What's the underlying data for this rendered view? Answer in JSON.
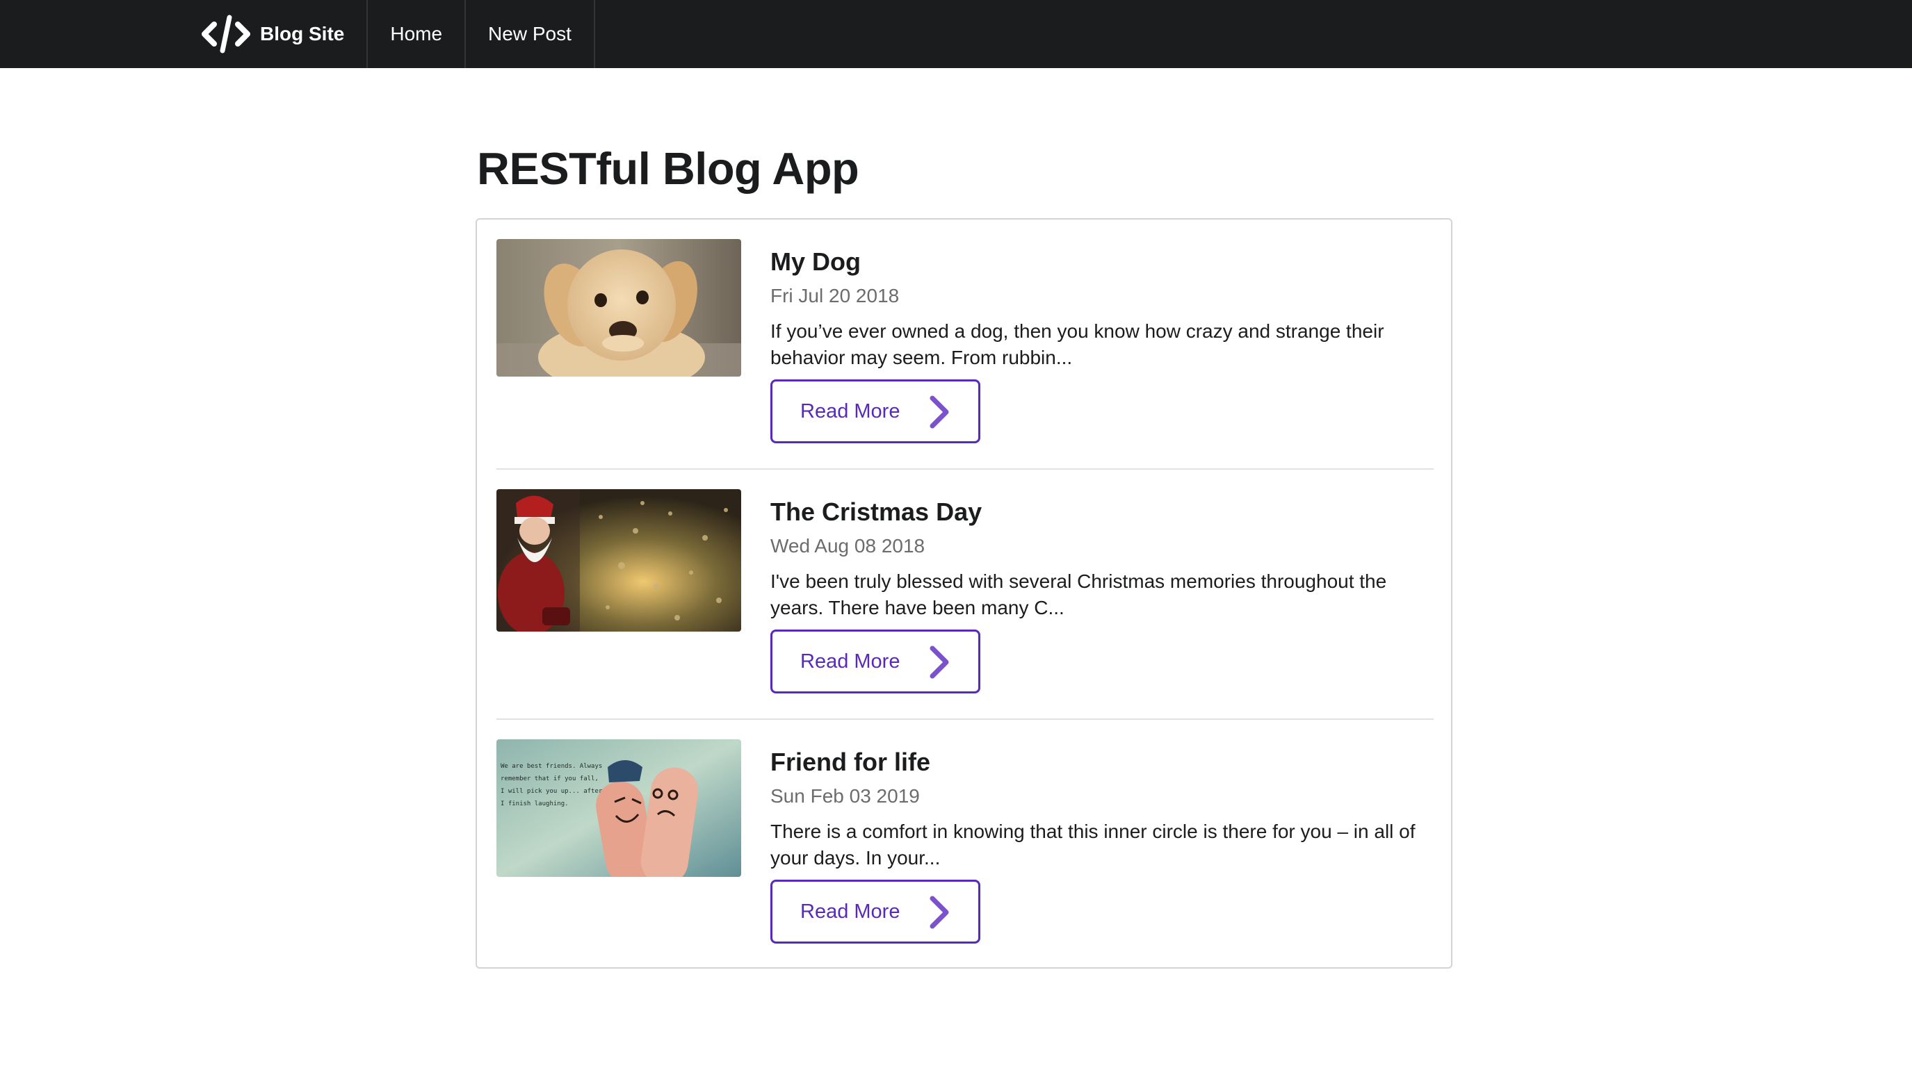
{
  "nav": {
    "brand_label": "Blog Site",
    "brand_icon": "code-icon",
    "links": [
      {
        "label": "Home"
      },
      {
        "label": "New Post"
      }
    ]
  },
  "page": {
    "title": "RESTful Blog App"
  },
  "posts": [
    {
      "title": "My Dog",
      "date": "Fri Jul 20 2018",
      "excerpt": "If you’ve ever owned a dog, then you know how crazy and strange their behavior may seem. From rubbin...",
      "button_label": "Read More",
      "image": "puppy-photo"
    },
    {
      "title": "The Cristmas Day",
      "date": "Wed Aug 08 2018",
      "excerpt": "I've been truly blessed with several Christmas memories throughout the years. There have been many C...",
      "button_label": "Read More",
      "image": "santa-christmas-tree-photo"
    },
    {
      "title": "Friend for life",
      "date": "Sun Feb 03 2019",
      "excerpt": "There is a comfort in knowing that this inner circle is there for you – in all of your days. In your...",
      "button_label": "Read More",
      "image": "finger-friends-photo",
      "image_caption": "We are best friends. Always remember that if you fall, I will pick you up... after I finish laughing."
    }
  ],
  "colors": {
    "navbar_bg": "#1b1c1d",
    "accent": "#5829bb",
    "border": "#d4d4d5",
    "muted_text": "#6c6c6c"
  }
}
